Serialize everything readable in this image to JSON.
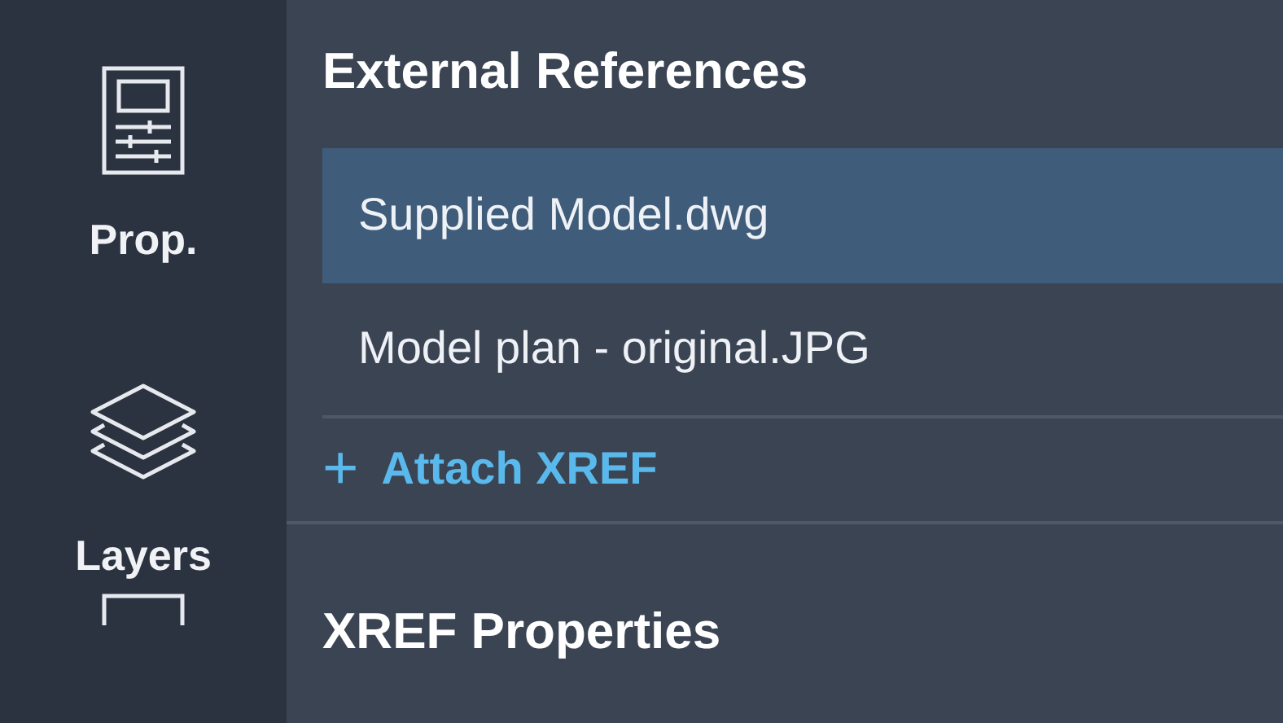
{
  "sidebar": {
    "items": [
      {
        "kind": "properties",
        "label": "Prop."
      },
      {
        "kind": "layers",
        "label": "Layers"
      }
    ]
  },
  "external_references": {
    "title": "External References",
    "files": [
      {
        "name": "Supplied Model.dwg",
        "selected": true
      },
      {
        "name": "Model plan - original.JPG",
        "selected": false
      }
    ],
    "attach": {
      "icon": "+",
      "label": "Attach XREF"
    }
  },
  "xref_properties": {
    "title": "XREF Properties"
  }
}
